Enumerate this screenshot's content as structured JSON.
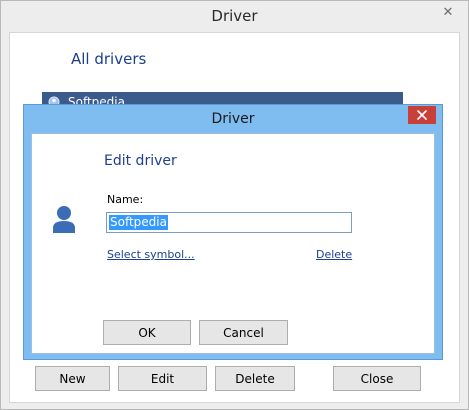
{
  "outer_window": {
    "title": "Driver",
    "close_glyph": "✕",
    "heading": "All drivers",
    "drivers": [
      {
        "name": "Softpedia",
        "icon": "driver-symbol-icon"
      }
    ],
    "buttons": {
      "new": "New",
      "edit": "Edit",
      "delete": "Delete",
      "close": "Close"
    }
  },
  "dialog": {
    "title": "Driver",
    "close_glyph": "✕",
    "heading": "Edit driver",
    "name_label": "Name:",
    "name_value": "Softpedia",
    "select_symbol_link": "Select symbol...",
    "delete_link": "Delete",
    "ok_label": "OK",
    "cancel_label": "Cancel"
  },
  "colors": {
    "accent": "#1d3f8e",
    "dialog_frame": "#7fbcf0",
    "close_red": "#c7403a",
    "selection": "#3399ff",
    "list_row": "#3c5b8d"
  }
}
